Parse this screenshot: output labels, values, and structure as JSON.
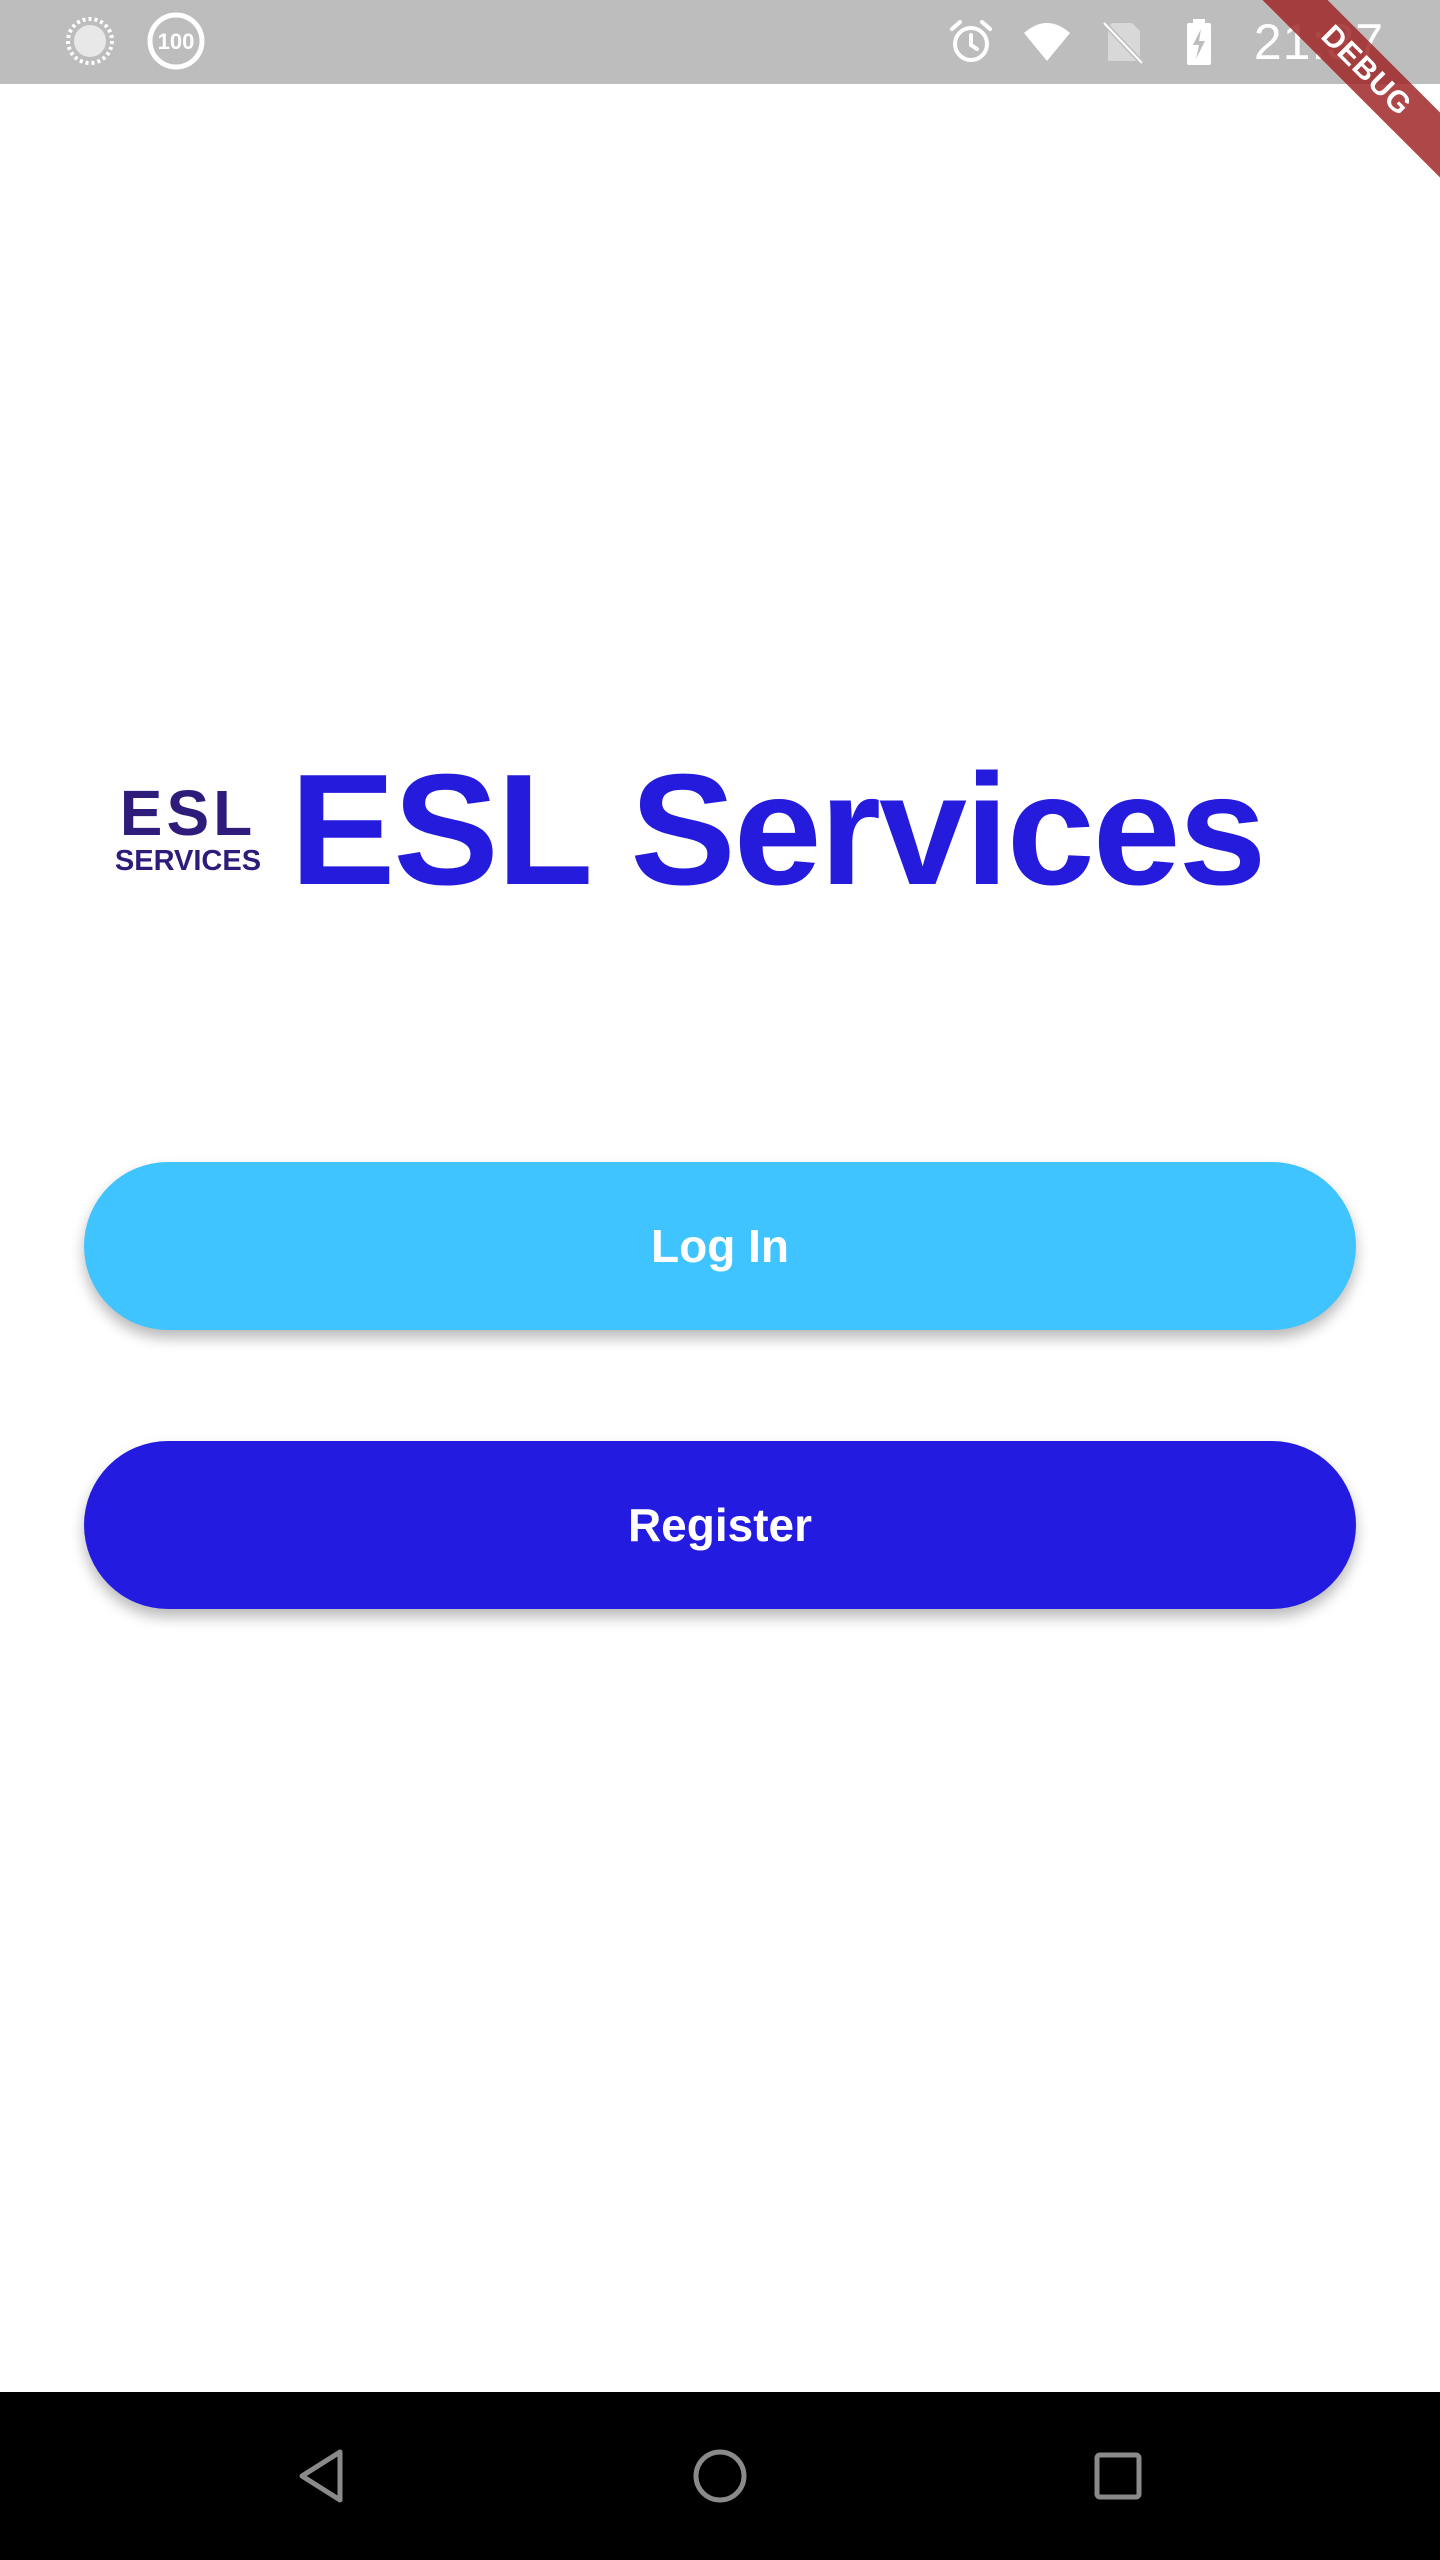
{
  "status_bar": {
    "time": "21:37",
    "left_icons": [
      "loading-spinner-icon",
      "badge-100-icon"
    ],
    "badge_text": "100",
    "right_icons": [
      "alarm-icon",
      "wifi-icon",
      "no-sim-icon",
      "battery-charging-icon"
    ]
  },
  "debug_banner": "DEBUG",
  "brand": {
    "logo_top": "ESL",
    "logo_bottom": "SERVICES",
    "title": "ESL Services",
    "title_color": "#241bdd",
    "logo_color": "#2e1b7a"
  },
  "actions": {
    "login_label": "Log In",
    "register_label": "Register",
    "login_color": "#40c4ff",
    "register_color": "#231bdf"
  },
  "navigation": {
    "buttons": [
      "back-icon",
      "home-icon",
      "recents-icon"
    ]
  }
}
